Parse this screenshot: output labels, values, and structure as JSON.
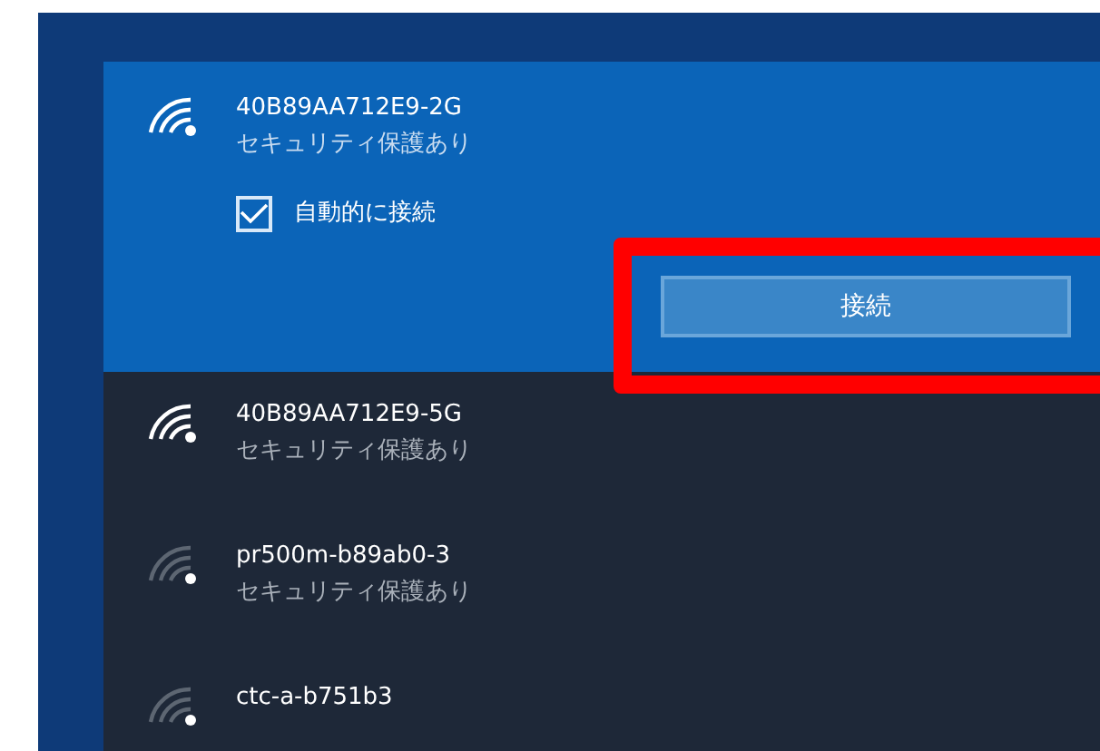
{
  "networks": [
    {
      "ssid": "40B89AA712E9-2G",
      "security": "セキュリティ保護あり",
      "selected": true,
      "kind": "strong",
      "auto_connect": {
        "label": "自動的に接続",
        "checked": true
      },
      "button": "接続"
    },
    {
      "ssid": "40B89AA712E9-5G",
      "security": "セキュリティ保護あり",
      "selected": false,
      "kind": "strong"
    },
    {
      "ssid": "pr500m-b89ab0-3",
      "security": "セキュリティ保護あり",
      "selected": false,
      "kind": "weak"
    },
    {
      "ssid": "ctc-a-b751b3",
      "selected": false,
      "kind": "weak"
    }
  ]
}
